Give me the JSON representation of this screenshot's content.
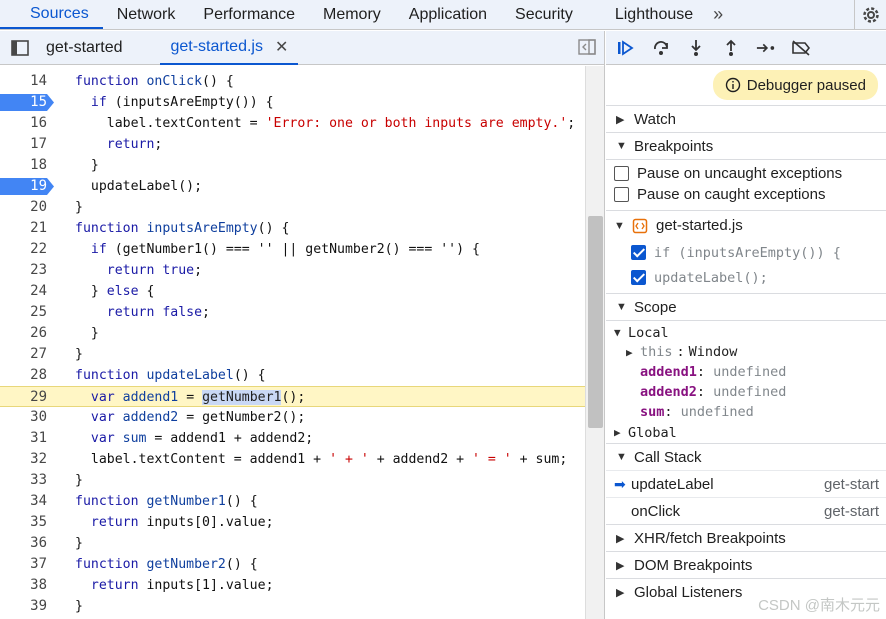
{
  "panel_tabs": [
    "Sources",
    "Network",
    "Performance",
    "Memory",
    "Application",
    "Security",
    "Lighthouse"
  ],
  "file_tabs": [
    "get-started",
    "get-started.js"
  ],
  "code_lines": [
    {
      "n": "14",
      "parts": [
        [
          "k",
          "function "
        ],
        [
          "fn",
          "onClick"
        ],
        [
          "v",
          "() {"
        ]
      ]
    },
    {
      "n": "15",
      "bp": true,
      "parts": [
        [
          "v",
          "  "
        ],
        [
          "k",
          "if"
        ],
        [
          "v",
          " ("
        ],
        [
          "v",
          "inputsAreEmpty()) {"
        ]
      ]
    },
    {
      "n": "16",
      "parts": [
        [
          "v",
          "    label.textContent = "
        ],
        [
          "s",
          "'Error: one or both inputs are empty.'"
        ],
        [
          "v",
          ";"
        ]
      ]
    },
    {
      "n": "17",
      "parts": [
        [
          "v",
          "    "
        ],
        [
          "k",
          "return"
        ],
        [
          "v",
          ";"
        ]
      ]
    },
    {
      "n": "18",
      "parts": [
        [
          "v",
          "  }"
        ]
      ]
    },
    {
      "n": "19",
      "bp": true,
      "parts": [
        [
          "v",
          "  updateLabel();"
        ]
      ]
    },
    {
      "n": "20",
      "parts": [
        [
          "v",
          "}"
        ]
      ]
    },
    {
      "n": "21",
      "parts": [
        [
          "k",
          "function "
        ],
        [
          "fn",
          "inputsAreEmpty"
        ],
        [
          "v",
          "() {"
        ]
      ]
    },
    {
      "n": "22",
      "parts": [
        [
          "v",
          "  "
        ],
        [
          "k",
          "if"
        ],
        [
          "v",
          " (getNumber1() === '' || getNumber2() === '') {"
        ]
      ]
    },
    {
      "n": "23",
      "parts": [
        [
          "v",
          "    "
        ],
        [
          "k",
          "return"
        ],
        [
          "k",
          " true"
        ],
        [
          "v",
          ";"
        ]
      ]
    },
    {
      "n": "24",
      "parts": [
        [
          "v",
          "  } "
        ],
        [
          "k",
          "else"
        ],
        [
          "v",
          " {"
        ]
      ]
    },
    {
      "n": "25",
      "parts": [
        [
          "v",
          "    "
        ],
        [
          "k",
          "return"
        ],
        [
          "k",
          " false"
        ],
        [
          "v",
          ";"
        ]
      ]
    },
    {
      "n": "26",
      "parts": [
        [
          "v",
          "  }"
        ]
      ]
    },
    {
      "n": "27",
      "parts": [
        [
          "v",
          "}"
        ]
      ]
    },
    {
      "n": "28",
      "parts": [
        [
          "k",
          "function "
        ],
        [
          "fn",
          "updateLabel"
        ],
        [
          "v",
          "() {"
        ]
      ]
    },
    {
      "n": "29",
      "hl": true,
      "parts": [
        [
          "v",
          "  "
        ],
        [
          "k",
          "var"
        ],
        [
          "fn",
          " addend1"
        ],
        [
          "v",
          " = "
        ],
        [
          "sel",
          "getNumber1"
        ],
        [
          "v",
          "();"
        ]
      ]
    },
    {
      "n": "30",
      "parts": [
        [
          "v",
          "  "
        ],
        [
          "k",
          "var"
        ],
        [
          "fn",
          " addend2"
        ],
        [
          "v",
          " = getNumber2();"
        ]
      ]
    },
    {
      "n": "31",
      "parts": [
        [
          "v",
          "  "
        ],
        [
          "k",
          "var"
        ],
        [
          "fn",
          " sum"
        ],
        [
          "v",
          " = addend1 + addend2;"
        ]
      ]
    },
    {
      "n": "32",
      "parts": [
        [
          "v",
          "  label.textContent = addend1 + "
        ],
        [
          "s",
          "' + '"
        ],
        [
          "v",
          " + addend2 + "
        ],
        [
          "s",
          "' = '"
        ],
        [
          "v",
          " + sum;"
        ]
      ]
    },
    {
      "n": "33",
      "parts": [
        [
          "v",
          "}"
        ]
      ]
    },
    {
      "n": "34",
      "parts": [
        [
          "k",
          "function "
        ],
        [
          "fn",
          "getNumber1"
        ],
        [
          "v",
          "() {"
        ]
      ]
    },
    {
      "n": "35",
      "parts": [
        [
          "v",
          "  "
        ],
        [
          "k",
          "return"
        ],
        [
          "v",
          " inputs[0].value;"
        ]
      ]
    },
    {
      "n": "36",
      "parts": [
        [
          "v",
          "}"
        ]
      ]
    },
    {
      "n": "37",
      "parts": [
        [
          "k",
          "function "
        ],
        [
          "fn",
          "getNumber2"
        ],
        [
          "v",
          "() {"
        ]
      ]
    },
    {
      "n": "38",
      "parts": [
        [
          "v",
          "  "
        ],
        [
          "k",
          "return"
        ],
        [
          "v",
          " inputs[1].value;"
        ]
      ]
    },
    {
      "n": "39",
      "parts": [
        [
          "v",
          "}"
        ]
      ]
    }
  ],
  "debugger": {
    "paused_label": "Debugger paused",
    "watch": "Watch",
    "breakpoints": "Breakpoints",
    "pause_uncaught": "Pause on uncaught exceptions",
    "pause_caught": "Pause on caught exceptions",
    "bp_file": "get-started.js",
    "bp_items": [
      "if (inputsAreEmpty()) {",
      "updateLabel();"
    ],
    "scope": "Scope",
    "local": "Local",
    "this_key": "this",
    "this_val": "Window",
    "vars": [
      {
        "name": "addend1",
        "val": "undefined"
      },
      {
        "name": "addend2",
        "val": "undefined"
      },
      {
        "name": "sum",
        "val": "undefined"
      }
    ],
    "global": "Global",
    "call_stack": "Call Stack",
    "frames": [
      {
        "name": "updateLabel",
        "loc": "get-start"
      },
      {
        "name": "onClick",
        "loc": "get-start"
      }
    ],
    "xhr": "XHR/fetch Breakpoints",
    "dom": "DOM Breakpoints",
    "listeners": "Global Listeners"
  },
  "watermark": "CSDN @南木元元",
  "colors": {
    "accent": "#0b57d0",
    "breakpoint": "#4285f4",
    "paused_bg": "#fdf1b6",
    "exec_line": "#fff6c5"
  }
}
